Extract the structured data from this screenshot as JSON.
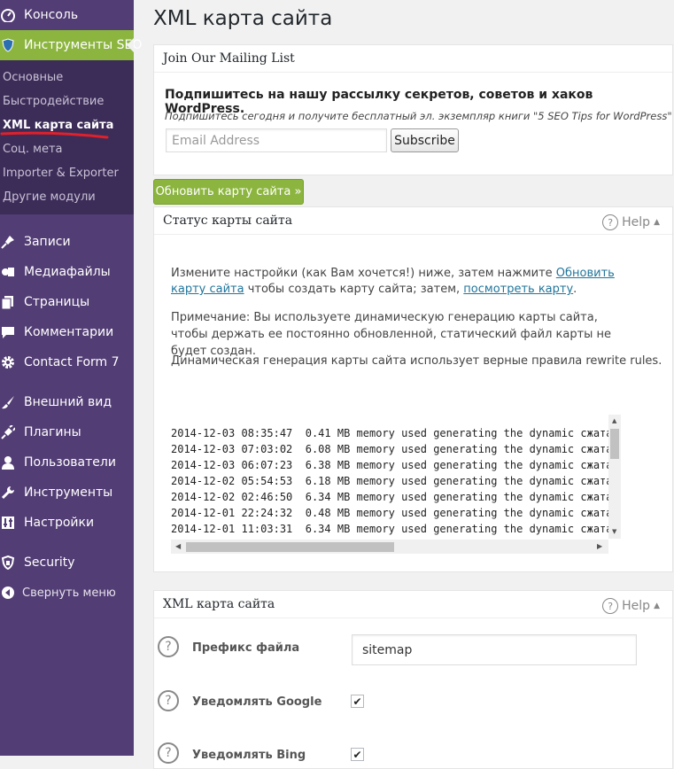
{
  "sidebar": {
    "console": "Консоль",
    "seo_tools": "Инструменты SEO",
    "submenu": [
      "Основные",
      "Быстродействие",
      "XML карта сайта",
      "Соц. мета",
      "Importer & Exporter",
      "Другие модули"
    ],
    "items": [
      "Записи",
      "Медиафайлы",
      "Страницы",
      "Комментарии",
      "Contact Form 7",
      "Внешний вид",
      "Плагины",
      "Пользователи",
      "Инструменты",
      "Настройки",
      "Security"
    ],
    "collapse": "Свернуть меню"
  },
  "page_title": "XML карта сайта",
  "mailing": {
    "title": "Join Our Mailing List",
    "headline": "Подпишитесь на нашу рассылку секретов, советов и хаков WordPress.",
    "subline": "Подпишитесь сегодня и получите бесплатный эл. экземпляр книги \"5 SEO Tips for WordPress\"",
    "email_placeholder": "Email Address",
    "subscribe": "Subscribe"
  },
  "update_button": "Обновить карту сайта »",
  "status": {
    "title": "Статус карты сайта",
    "help": "Help",
    "p1_before": "Измените настройки (как Вам хочется!) ниже, затем нажмите ",
    "p1_link1": "Обновить карту сайта",
    "p1_mid": " чтобы создать карту сайта; затем, ",
    "p1_link2": "посмотреть карту",
    "p1_after": ".",
    "p2": "Примечание: Вы используете динамическую генерацию карты сайта, чтобы держать ее постоянно обновленной, статический файл карты не будет создан.",
    "p3": "Динамическая генерация карты сайта использует верные правила rewrite rules.",
    "log": [
      "2014-12-03 08:35:47  0.41 MB memory used generating the dynamic сжата",
      "2014-12-03 07:03:02  6.08 MB memory used generating the dynamic сжата",
      "2014-12-03 06:07:23  6.38 MB memory used generating the dynamic сжата",
      "2014-12-02 05:54:53  6.18 MB memory used generating the dynamic сжата",
      "2014-12-02 02:46:50  6.34 MB memory used generating the dynamic сжата",
      "2014-12-01 22:24:32  0.48 MB memory used generating the dynamic сжата",
      "2014-12-01 11:03:31  6.34 MB memory used generating the dynamic сжата"
    ]
  },
  "xml": {
    "title": "XML карта сайта",
    "help": "Help",
    "prefix_label": "Префикс файла",
    "prefix_value": "sitemap",
    "google_label": "Уведомлять Google",
    "bing_label": "Уведомлять Bing"
  },
  "colors": {
    "sidebar": "#523d74",
    "submenu": "#3c2c58",
    "accent": "#8cb53f",
    "link": "#21759b"
  }
}
